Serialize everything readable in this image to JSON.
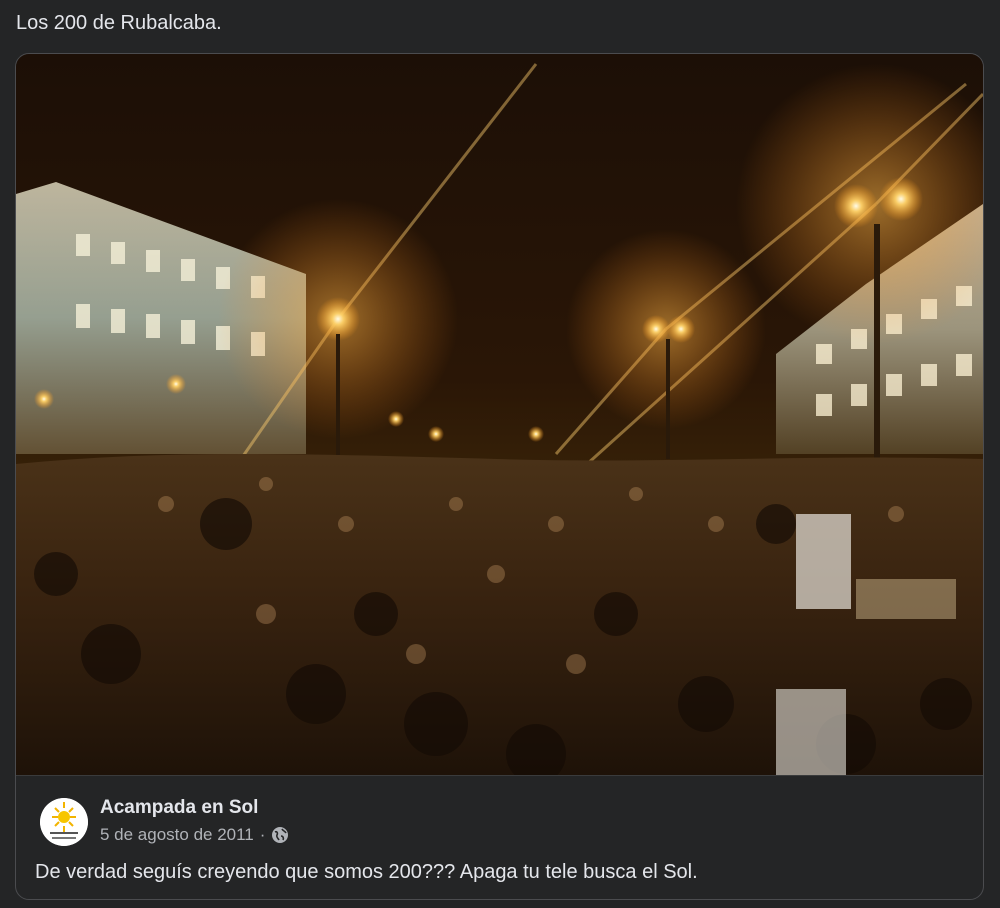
{
  "post": {
    "text": "Los 200 de Rubalcaba."
  },
  "shared_post": {
    "image": {
      "description_icon": "crowd-photo"
    },
    "author": "Acampada en Sol",
    "date": "5 de agosto de 2011",
    "separator": "·",
    "privacy_icon": "globe-icon",
    "text": "De verdad seguís creyendo que somos 200??? Apaga tu tele busca el Sol."
  },
  "colors": {
    "background": "#242526",
    "text_primary": "#e4e6eb",
    "text_secondary": "#b0b3b8",
    "border": "#4b4c4f"
  }
}
